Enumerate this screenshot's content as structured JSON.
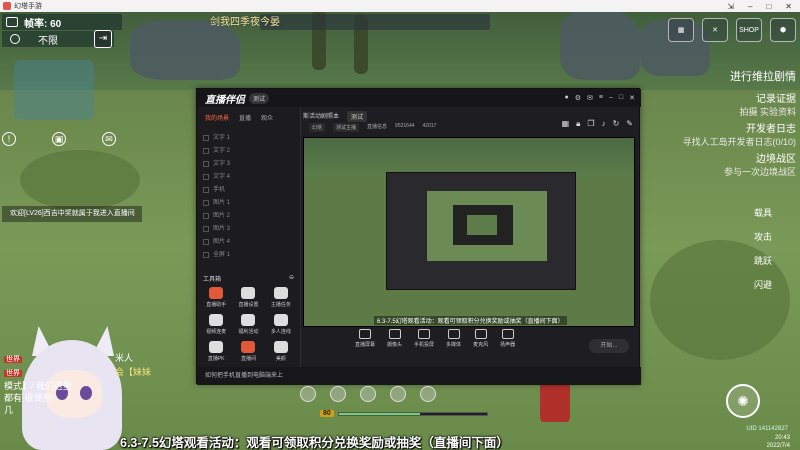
{
  "window": {
    "title": "幻塔手游"
  },
  "hud": {
    "fps_label": "帧率: 60",
    "limit_label": "不限",
    "banner": "剑我四季夜今晏"
  },
  "top_right": {
    "shop_label": "SHOP"
  },
  "quests": {
    "main": "进行维拉剧情",
    "items": [
      {
        "title": "记录证据",
        "sub": "拍摄 实验资料"
      },
      {
        "title": "开发者日志",
        "sub": "寻找人工岛开发者日志(0/10)"
      },
      {
        "title": "边境战区",
        "sub": "参与一次边境战区"
      }
    ]
  },
  "right_actions": [
    "载具",
    "攻击",
    "跳跃",
    "闪避"
  ],
  "chat": {
    "system_line": "欢迎[LV26]西吉中奖就属于我进入直播间",
    "lines": [
      {
        "tag": "世界",
        "text": "米人"
      },
      {
        "tag": "世界",
        "text": "会【妹妹"
      },
      {
        "tag": "",
        "text": "模式】/ 我们这里"
      },
      {
        "tag": "",
        "text": "都有 很便用!"
      },
      {
        "tag": "",
        "text": "几"
      }
    ]
  },
  "obs": {
    "app_name": "直播伴侣",
    "version": "测试",
    "side_tabs": [
      "我的场景",
      "直播",
      "观众"
    ],
    "scenes": [
      "文字 1",
      "文字 2",
      "文字 3",
      "文字 4",
      "手机",
      "图片 1",
      "图片 2",
      "图片 3",
      "图片 4",
      "全屏 1"
    ],
    "tools_title": "工具箱",
    "tools": [
      "直播助手",
      "直播设置",
      "主播任务",
      "视频连麦",
      "福利活动",
      "多人连线",
      "直播PK",
      "直播间",
      "美颜"
    ],
    "stream_title": "斯活动剧照本",
    "stream_tag": "测试",
    "stream_sub": [
      "幻塔",
      "测试主播",
      "直播信息",
      "9521644",
      "42017"
    ],
    "preview_caption": "6.3-7.5幻塔观看活动：观看可领取积分兑换奖励或抽奖（直播间下面）",
    "bottom_buttons": [
      "直播屏幕",
      "摄像头",
      "手机投屏",
      "多媒体",
      "麦克风",
      "扬声器"
    ],
    "start_label": "开始...",
    "notice": "如何把手机直播到电脑端来上"
  },
  "bottom_hud": {
    "level": "80",
    "exp_fraction": 0.55
  },
  "subtitle": "6.3-7.5幻塔观看活动：观看可领取积分兑换奖励或抽奖（直播间下面）",
  "uid": "UID 141142827",
  "clock": {
    "time": "20:43",
    "date": "2022/7/4"
  }
}
